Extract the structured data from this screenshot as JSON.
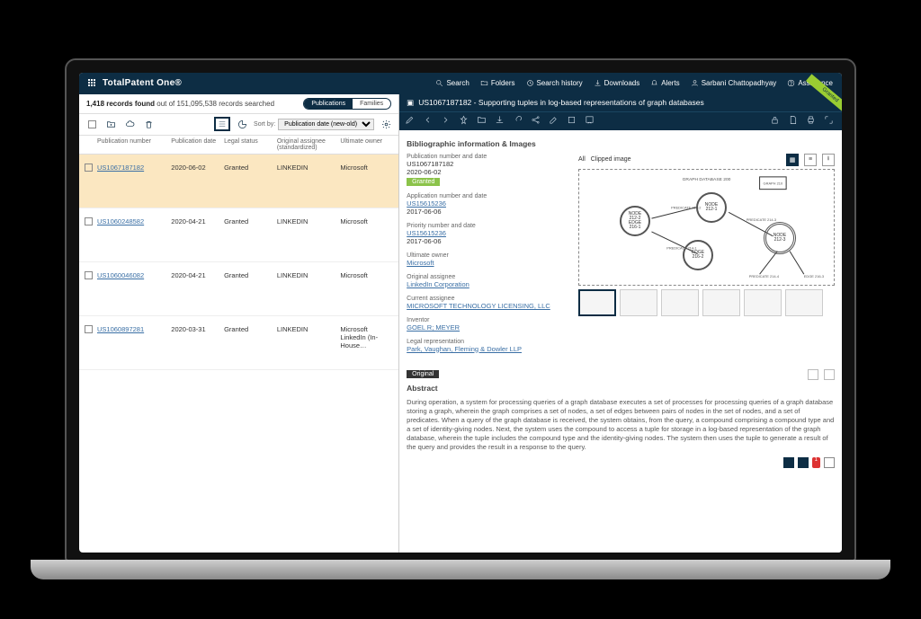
{
  "brand": "TotalPatent One®",
  "nav": {
    "search": "Search",
    "folders": "Folders",
    "history": "Search history",
    "downloads": "Downloads",
    "alerts": "Alerts",
    "user": "Sarbani Chattopadhyay",
    "assistance": "Assistance"
  },
  "results": {
    "count": "1,418 records found",
    "total_text": " out of 151,095,538 records searched",
    "tabs": {
      "publications": "Publications",
      "families": "Families"
    },
    "sort_label": "Sort by:",
    "sort_value": "Publication date (new-old)",
    "columns": {
      "pub_no": "Publication number",
      "pub_date": "Publication date",
      "legal": "Legal status",
      "orig": "Original assignee (standardized)",
      "owner": "Ultimate owner"
    },
    "rows": [
      {
        "pub": "US1067187182",
        "date": "2020-06-02",
        "legal": "Granted",
        "assignee": "LINKEDIN",
        "owner": "Microsoft",
        "selected": true
      },
      {
        "pub": "US1060248582",
        "date": "2020-04-21",
        "legal": "Granted",
        "assignee": "LINKEDIN",
        "owner": "Microsoft"
      },
      {
        "pub": "US1060046082",
        "date": "2020-04-21",
        "legal": "Granted",
        "assignee": "LINKEDIN",
        "owner": "Microsoft"
      },
      {
        "pub": "US1060897281",
        "date": "2020-03-31",
        "legal": "Granted",
        "assignee": "LINKEDIN",
        "owner": "Microsoft\nLinkedIn (In-House…"
      }
    ]
  },
  "document": {
    "title": "US1067187182 - Supporting tuples in log-based representations of graph databases",
    "ribbon": "Granted",
    "section_biblio": "Bibliographic information & Images",
    "figure_tabs": {
      "all": "All",
      "clipped": "Clipped image"
    },
    "biblio": {
      "pub_label": "Publication number and date",
      "pub_no": "US1067187182",
      "pub_date": "2020-06-02",
      "status": "Granted",
      "app_label": "Application number and date",
      "app_no": "US15615236",
      "app_date": "2017-06-06",
      "prio_label": "Priority number and date",
      "prio_no": "US15615236",
      "prio_date": "2017-06-06",
      "owner_label": "Ultimate owner",
      "owner": "Microsoft",
      "orig_label": "Original assignee",
      "orig": "LinkedIn Corporation",
      "cur_label": "Current assignee",
      "cur": "MICROSOFT TECHNOLOGY LICENSING, LLC",
      "inv_label": "Inventor",
      "inv": "GOEL R; MEYER",
      "rep_label": "Legal representation",
      "rep": "Park, Vaughan, Fleming & Dowler LLP"
    },
    "abstract_title": "Abstract",
    "abstract_tab": "Original",
    "abstract": "During operation, a system for processing queries of a graph database executes a set of processes for processing queries of a graph database storing a graph, wherein the graph comprises a set of nodes, a set of edges between pairs of nodes in the set of nodes, and a set of predicates. When a query of the graph database is received, the system obtains, from the query, a compound comprising a compound type and a set of identity-giving nodes. Next, the system uses the compound to access a tuple for storage in a log-based representation of the graph database, wherein the tuple includes the compound type and the identity-giving nodes. The system then uses the tuple to generate a result of the query and provides the result in a response to the query."
  }
}
